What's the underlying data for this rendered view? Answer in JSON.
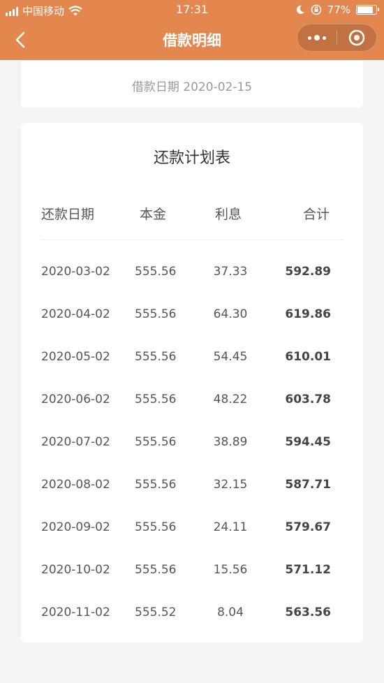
{
  "status_bar": {
    "carrier": "中国移动",
    "time": "17:31",
    "battery": "77%"
  },
  "nav": {
    "title": "借款明细"
  },
  "loan": {
    "date_text": "借款日期 2020-02-15"
  },
  "schedule": {
    "title": "还款计划表",
    "headers": [
      "还款日期",
      "本金",
      "利息",
      "合计"
    ],
    "rows": [
      {
        "date": "2020-03-02",
        "principal": "555.56",
        "interest": "37.33",
        "total": "592.89"
      },
      {
        "date": "2020-04-02",
        "principal": "555.56",
        "interest": "64.30",
        "total": "619.86"
      },
      {
        "date": "2020-05-02",
        "principal": "555.56",
        "interest": "54.45",
        "total": "610.01"
      },
      {
        "date": "2020-06-02",
        "principal": "555.56",
        "interest": "48.22",
        "total": "603.78"
      },
      {
        "date": "2020-07-02",
        "principal": "555.56",
        "interest": "38.89",
        "total": "594.45"
      },
      {
        "date": "2020-08-02",
        "principal": "555.56",
        "interest": "32.15",
        "total": "587.71"
      },
      {
        "date": "2020-09-02",
        "principal": "555.56",
        "interest": "24.11",
        "total": "579.67"
      },
      {
        "date": "2020-10-02",
        "principal": "555.56",
        "interest": "15.56",
        "total": "571.12"
      },
      {
        "date": "2020-11-02",
        "principal": "555.52",
        "interest": "8.04",
        "total": "563.56"
      }
    ]
  },
  "colors": {
    "header": "#e4874e",
    "background": "#f4f4f4",
    "card": "#ffffff"
  }
}
